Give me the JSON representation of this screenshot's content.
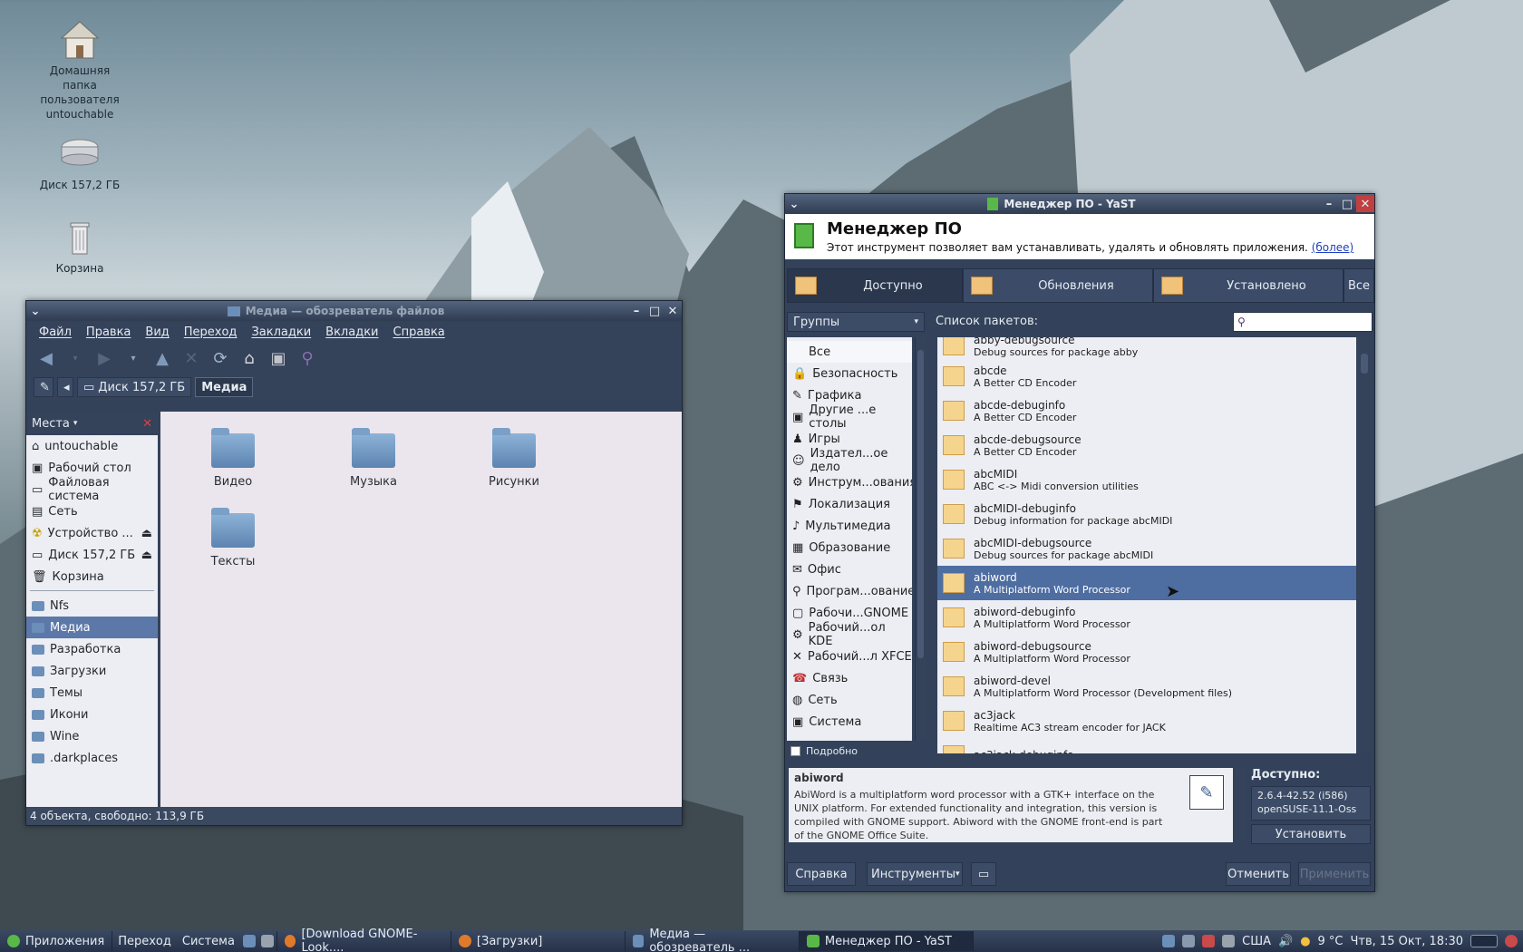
{
  "desktop": {
    "icons": [
      {
        "label": "Домашняя папка пользователя untouchable",
        "icon": "home-icon"
      },
      {
        "label": "Диск 157,2 ГБ",
        "icon": "drive-icon"
      },
      {
        "label": "Корзина",
        "icon": "trash-icon"
      }
    ]
  },
  "nautilus": {
    "title": "Медиа — обозреватель файлов",
    "menu": [
      "Файл",
      "Правка",
      "Вид",
      "Переход",
      "Закладки",
      "Вкладки",
      "Справка"
    ],
    "path": {
      "drive": "Диск 157,2 ГБ",
      "current": "Медиа"
    },
    "side_header": "Места",
    "places": [
      "untouchable",
      "Рабочий стол",
      "Файловая система",
      "Сеть",
      "Устройство ...",
      "Диск 157,2 ГБ",
      "Корзина"
    ],
    "bookmarks": [
      "Nfs",
      "Медиа",
      "Разработка",
      "Загрузки",
      "Темы",
      "Икони",
      "Wine",
      ".darkplaces"
    ],
    "selected_bookmark": "Медиа",
    "files": [
      "Видео",
      "Музыка",
      "Рисунки",
      "Тексты"
    ],
    "status": "4 объекта, свободно: 113,9 ГБ"
  },
  "yast": {
    "title": "Менеджер ПО - YaST",
    "heading": "Менеджер ПО",
    "subheading": "Этот инструмент позволяет вам устанавливать, удалять и обновлять приложения.",
    "more_link": "(более)",
    "tabs": [
      "Доступно",
      "Обновления",
      "Установлено",
      "Все"
    ],
    "groups_label": "Группы",
    "packages_label": "Список пакетов:",
    "groups": [
      "Все",
      "Безопасность",
      "Графика",
      "Другие ...е столы",
      "Игры",
      "Издател...ое дело",
      "Инструм...ования",
      "Локализация",
      "Мультимедиа",
      "Образование",
      "Офис",
      "Програм...ование",
      "Рабочи...GNOME",
      "Рабочий...ол KDE",
      "Рабочий...л XFCE",
      "Связь",
      "Сеть",
      "Система"
    ],
    "details_checkbox": "Подробно",
    "packages": [
      {
        "name": "abby-debugsource",
        "desc": "Debug sources for package abby"
      },
      {
        "name": "abcde",
        "desc": "A Better CD Encoder"
      },
      {
        "name": "abcde-debuginfo",
        "desc": "A Better CD Encoder"
      },
      {
        "name": "abcde-debugsource",
        "desc": "A Better CD Encoder"
      },
      {
        "name": "abcMIDI",
        "desc": "ABC <-> Midi conversion utilities"
      },
      {
        "name": "abcMIDI-debuginfo",
        "desc": "Debug information for package abcMIDI"
      },
      {
        "name": "abcMIDI-debugsource",
        "desc": "Debug sources for package abcMIDI"
      },
      {
        "name": "abiword",
        "desc": "A Multiplatform Word Processor"
      },
      {
        "name": "abiword-debuginfo",
        "desc": "A Multiplatform Word Processor"
      },
      {
        "name": "abiword-debugsource",
        "desc": "A Multiplatform Word Processor"
      },
      {
        "name": "abiword-devel",
        "desc": "A Multiplatform Word Processor (Development files)"
      },
      {
        "name": "ac3jack",
        "desc": "Realtime AC3 stream encoder for JACK"
      },
      {
        "name": "ac3jack-debuginfo",
        "desc": ""
      }
    ],
    "selected_package": "abiword",
    "desc_title": "abiword",
    "desc_text": "AbiWord is a multiplatform word processor with a GTK+ interface on the UNIX platform. For extended functionality and integration, this version is compiled with GNOME support. Abiword with the GNOME front-end is part of the GNOME Office Suite.",
    "available_label": "Доступно:",
    "version": "2.6.4-42.52",
    "arch": "(i586)",
    "repo": "openSUSE-11.1-Oss",
    "install_button": "Установить",
    "help_button": "Справка",
    "tools_button": "Инструменты",
    "cancel_button": "Отменить",
    "apply_button": "Применить"
  },
  "taskbar": {
    "menus": [
      "Приложения",
      "Переход",
      "Система"
    ],
    "tasks": [
      "[Download GNOME-Look....",
      "[Загрузки]",
      "Медиа — обозреватель ...",
      "Менеджер ПО - YaST"
    ],
    "keyboard": "США",
    "weather": "9 °C",
    "clock": "Чтв, 15 Окт, 18:30"
  }
}
